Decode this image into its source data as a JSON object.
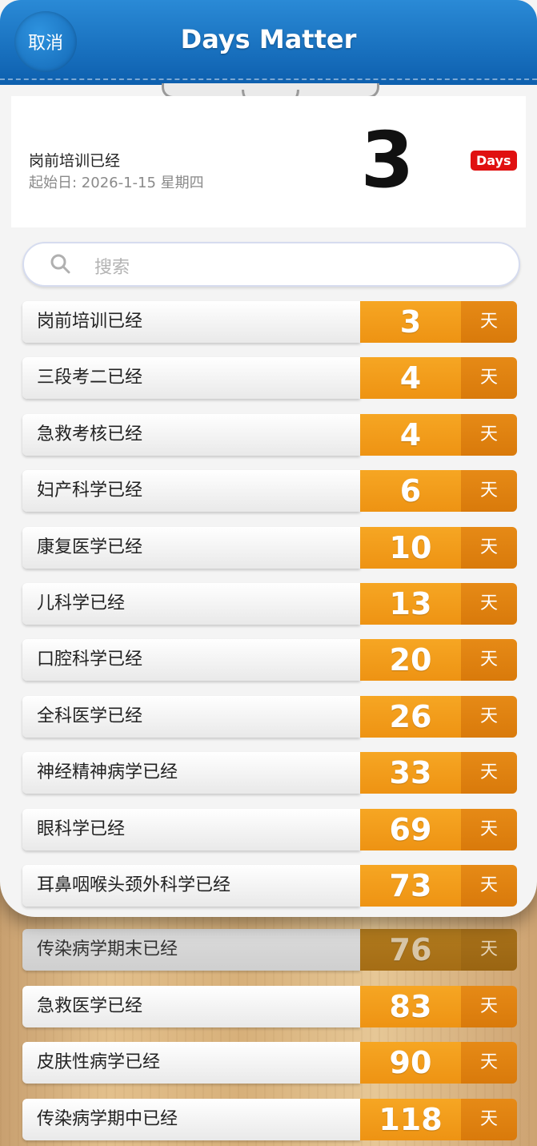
{
  "header": {
    "cancel_label": "取消",
    "title": "Days Matter"
  },
  "highlight": {
    "name": "岗前培训已经",
    "start_date": "起始日: 2026-1-15 星期四",
    "days": "3",
    "badge": "Days"
  },
  "search": {
    "placeholder": "搜索"
  },
  "unit_label": "天",
  "events": [
    {
      "name": "岗前培训已经",
      "days": "3"
    },
    {
      "name": "三段考二已经",
      "days": "4"
    },
    {
      "name": "急救考核已经",
      "days": "4"
    },
    {
      "name": "妇产科学已经",
      "days": "6"
    },
    {
      "name": "康复医学已经",
      "days": "10"
    },
    {
      "name": "儿科学已经",
      "days": "13"
    },
    {
      "name": "口腔科学已经",
      "days": "20"
    },
    {
      "name": "全科医学已经",
      "days": "26"
    },
    {
      "name": "神经精神病学已经",
      "days": "33"
    },
    {
      "name": "眼科学已经",
      "days": "69"
    },
    {
      "name": "耳鼻咽喉头颈外科学已经",
      "days": "73"
    },
    {
      "name": "传染病学期末已经",
      "days": "76"
    },
    {
      "name": "急救医学已经",
      "days": "83"
    },
    {
      "name": "皮肤性病学已经",
      "days": "90"
    },
    {
      "name": "传染病学期中已经",
      "days": "118"
    }
  ],
  "colors": {
    "header_blue": "#1a74c4",
    "accent_orange": "#f29c1c",
    "badge_red": "#e01010"
  }
}
